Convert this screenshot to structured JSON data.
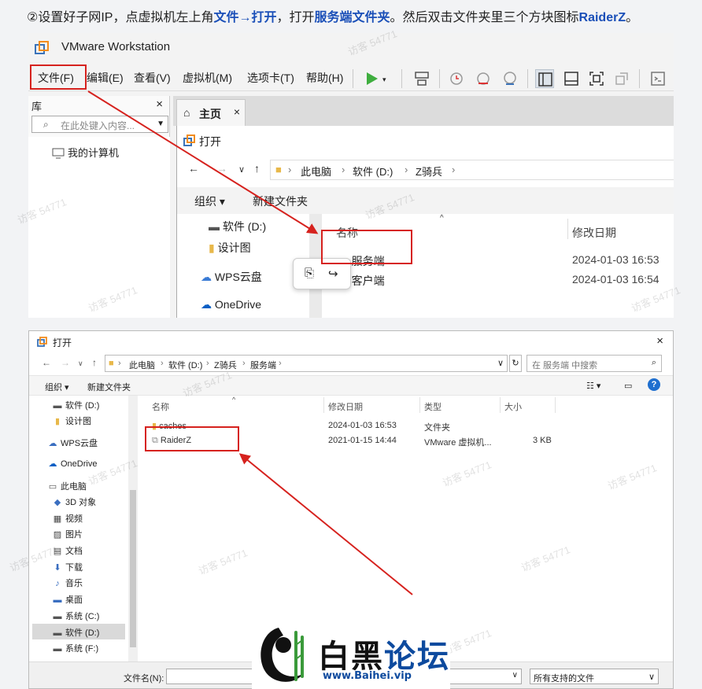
{
  "instruction": {
    "prefix": "②设置好子网IP，点虚拟机左上角",
    "hl1": "文件→打开",
    "mid": "，打开",
    "hl2": "服务端文件夹",
    "mid2": "。然后双击文件夹里三个方块图标",
    "hl3": "RaiderZ",
    "suffix": "。"
  },
  "vmware": {
    "title": "VMware Workstation",
    "menu": [
      "文件(F)",
      "编辑(E)",
      "查看(V)",
      "虚拟机(M)",
      "选项卡(T)",
      "帮助(H)"
    ],
    "library": {
      "header": "库",
      "close": "×",
      "search_placeholder": "在此处键入内容...",
      "item": "我的计算机"
    },
    "tab": {
      "label": "主页",
      "close": "×"
    },
    "open_dialog": {
      "title": "打开",
      "breadcrumb": [
        "此电脑",
        "软件 (D:)",
        "Z骑兵"
      ],
      "organize": "组织 ▾",
      "new_folder": "新建文件夹",
      "nav_items": [
        "软件 (D:)",
        "设计图",
        "WPS云盘",
        "OneDrive"
      ],
      "columns": {
        "name": "名称",
        "modified": "修改日期"
      },
      "rows": [
        {
          "name": "服务端",
          "modified": "2024-01-03 16:53"
        },
        {
          "name": "客户端",
          "modified": "2024-01-03 16:54"
        }
      ]
    }
  },
  "open2": {
    "title": "打开",
    "close": "×",
    "breadcrumb": [
      "此电脑",
      "软件 (D:)",
      "Z骑兵",
      "服务端"
    ],
    "search_placeholder": "在 服务端 中搜索",
    "organize": "组织 ▾",
    "new_folder": "新建文件夹",
    "nav_items": [
      "软件 (D:)",
      "设计图",
      "WPS云盘",
      "OneDrive",
      "此电脑",
      "3D 对象",
      "视频",
      "图片",
      "文档",
      "下载",
      "音乐",
      "桌面",
      "系统 (C:)",
      "软件 (D:)",
      "系统 (F:)"
    ],
    "columns": {
      "name": "名称",
      "modified": "修改日期",
      "type": "类型",
      "size": "大小"
    },
    "rows": [
      {
        "name": "caches",
        "modified": "2024-01-03 16:53",
        "type": "文件夹",
        "size": ""
      },
      {
        "name": "RaiderZ",
        "modified": "2021-01-15 14:44",
        "type": "VMware 虚拟机...",
        "size": "3 KB"
      }
    ],
    "filename_label": "文件名(N):",
    "filter": "所有支持的文件"
  },
  "watermark": "访客 54771",
  "logo": {
    "cn_black": "白黑",
    "cn_blue": "论坛",
    "url": "www.Baihei.vip"
  },
  "colors": {
    "highlight": "#1a4fb8",
    "annotation_red": "#d6221e",
    "folder": "#e8b84a"
  }
}
